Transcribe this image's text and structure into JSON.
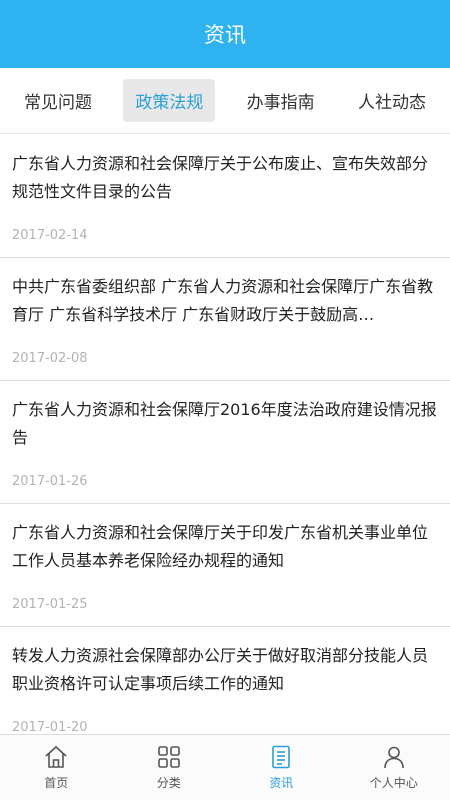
{
  "header": {
    "title": "资讯"
  },
  "tabs": [
    {
      "label": "常见问题",
      "active": false
    },
    {
      "label": "政策法规",
      "active": true
    },
    {
      "label": "办事指南",
      "active": false
    },
    {
      "label": "人社动态",
      "active": false
    }
  ],
  "articles": [
    {
      "title": "广东省人力资源和社会保障厅关于公布废止、宣布失效部分规范性文件目录的公告",
      "date": "2017-02-14"
    },
    {
      "title": "中共广东省委组织部 广东省人力资源和社会保障厅广东省教育厅 广东省科学技术厅 广东省财政厅关于鼓励高…",
      "date": "2017-02-08"
    },
    {
      "title": "广东省人力资源和社会保障厅2016年度法治政府建设情况报告",
      "date": "2017-01-26"
    },
    {
      "title": "广东省人力资源和社会保障厅关于印发广东省机关事业单位工作人员基本养老保险经办规程的通知",
      "date": "2017-01-25"
    },
    {
      "title": "转发人力资源社会保障部办公厅关于做好取消部分技能人员职业资格许可认定事项后续工作的通知",
      "date": "2017-01-20"
    }
  ],
  "bottom_nav": [
    {
      "label": "首页",
      "icon": "home-icon",
      "active": false
    },
    {
      "label": "分类",
      "icon": "grid-icon",
      "active": false
    },
    {
      "label": "资讯",
      "icon": "document-icon",
      "active": true
    },
    {
      "label": "个人中心",
      "icon": "user-icon",
      "active": false
    }
  ],
  "colors": {
    "header_bg": "#2fb2f0",
    "accent": "#2b9fd8",
    "date_text": "#b3b3b3"
  }
}
